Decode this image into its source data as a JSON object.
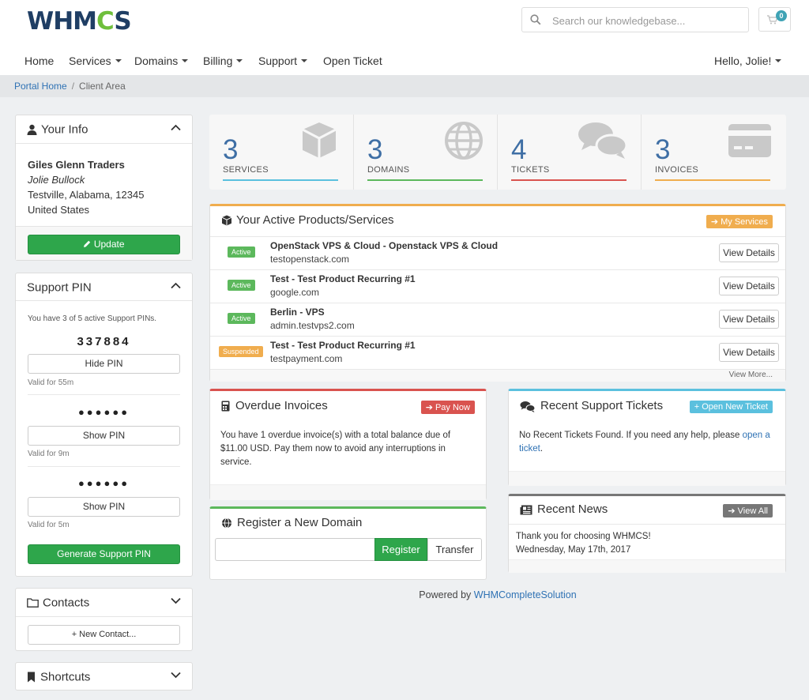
{
  "header": {
    "logo_text": "WHMCS",
    "search_placeholder": "Search our knowledgebase...",
    "cart_count": "0"
  },
  "nav": {
    "items": [
      "Home",
      "Services",
      "Domains",
      "Billing",
      "Support",
      "Open Ticket"
    ],
    "user": "Hello, Jolie!"
  },
  "breadcrumb": {
    "home": "Portal Home",
    "current": "Client Area"
  },
  "your_info": {
    "title": "Your Info",
    "company": "Giles Glenn Traders",
    "name": "Jolie Bullock",
    "city": "Testville, Alabama, 12345",
    "country": "United States",
    "update_label": "Update"
  },
  "support_pin": {
    "title": "Support PIN",
    "summary": "You have 3 of 5 active Support PINs.",
    "pins": [
      {
        "value": "337884",
        "button": "Hide PIN",
        "valid": "Valid for 55m"
      },
      {
        "value": "●●●●●●",
        "button": "Show PIN",
        "valid": "Valid for 9m"
      },
      {
        "value": "●●●●●●",
        "button": "Show PIN",
        "valid": "Valid for 5m"
      }
    ],
    "generate_label": "Generate Support PIN"
  },
  "contacts": {
    "title": "Contacts",
    "new_label": "+ New Contact..."
  },
  "shortcuts": {
    "title": "Shortcuts"
  },
  "stats": [
    {
      "num": "3",
      "label": "SERVICES",
      "color": "#5bc0de"
    },
    {
      "num": "3",
      "label": "DOMAINS",
      "color": "#5cb85c"
    },
    {
      "num": "4",
      "label": "TICKETS",
      "color": "#d9534f"
    },
    {
      "num": "3",
      "label": "INVOICES",
      "color": "#f0ad4e"
    }
  ],
  "products": {
    "title": "Your Active Products/Services",
    "my_services_label": "My Services",
    "rows": [
      {
        "status": "Active",
        "name": "OpenStack VPS & Cloud - Openstack VPS & Cloud",
        "domain": "testopenstack.com",
        "button": "View Details"
      },
      {
        "status": "Active",
        "name": "Test - Test Product Recurring #1",
        "domain": "google.com",
        "button": "View Details"
      },
      {
        "status": "Active",
        "name": "Berlin - VPS",
        "domain": "admin.testvps2.com",
        "button": "View Details"
      },
      {
        "status": "Suspended",
        "name": "Test - Test Product Recurring #1",
        "domain": "testpayment.com",
        "button": "View Details"
      }
    ],
    "view_more": "View More..."
  },
  "overdue": {
    "title": "Overdue Invoices",
    "pay_now_label": "Pay Now",
    "text": "You have 1 overdue invoice(s) with a total balance due of $11.00 USD. Pay them now to avoid any interruptions in service."
  },
  "tickets": {
    "title": "Recent Support Tickets",
    "open_label": "Open New Ticket",
    "text": "No Recent Tickets Found. If you need any help, please ",
    "link": "open a ticket",
    "text_end": "."
  },
  "domain_reg": {
    "title": "Register a New Domain",
    "register_label": "Register",
    "transfer_label": "Transfer"
  },
  "news": {
    "title": "Recent News",
    "view_all_label": "View All",
    "item_title": "Thank you for choosing WHMCS!",
    "item_date": "Wednesday, May 17th, 2017"
  },
  "footer": {
    "prefix": "Powered by ",
    "link": "WHMCompleteSolution"
  }
}
